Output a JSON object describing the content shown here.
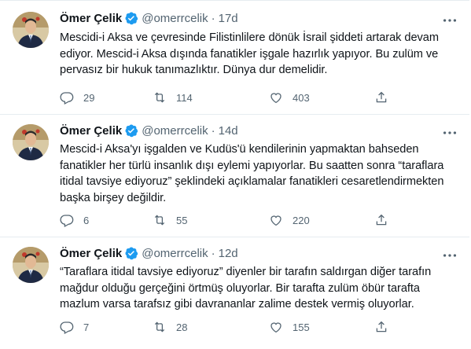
{
  "tweets": [
    {
      "name": "Ömer Çelik",
      "handle": "@omerrcelik",
      "separator": "·",
      "time": "17d",
      "text": "Mescidi-i Aksa ve çevresinde Filistinlilere dönük İsrail şiddeti artarak devam ediyor. Mescid-i Aksa dışında fanatikler işgale hazırlık yapıyor. Bu zulüm ve pervasız bir hukuk tanımazlıktır. Dünya dur demelidir.",
      "replies": "29",
      "retweets": "114",
      "likes": "403"
    },
    {
      "name": "Ömer Çelik",
      "handle": "@omerrcelik",
      "separator": "·",
      "time": "14d",
      "text": "Mescid-i Aksa'yı işgalden ve Kudüs'ü kendilerinin yapmaktan bahseden fanatikler her türlü insanlık dışı eylemi yapıyorlar. Bu saatten sonra “taraflara itidal tavsiye ediyoruz” şeklindeki açıklamalar fanatikleri cesaretlendirmekten başka birşey değildir.",
      "replies": "6",
      "retweets": "55",
      "likes": "220"
    },
    {
      "name": "Ömer Çelik",
      "handle": "@omerrcelik",
      "separator": "·",
      "time": "12d",
      "text": "“Taraflara itidal tavsiye ediyoruz” diyenler bir tarafın saldırgan diğer tarafın mağdur olduğu gerçeğini örtmüş oluyorlar. Bir tarafta zulüm öbür tarafta mazlum varsa tarafsız gibi davrananlar zalime destek vermiş oluyorlar.",
      "replies": "7",
      "retweets": "28",
      "likes": "155"
    }
  ],
  "icons": {
    "verified": "verified-badge-icon",
    "more": "more-options-icon",
    "reply": "reply-icon",
    "retweet": "retweet-icon",
    "like": "like-icon",
    "share": "share-icon"
  },
  "colors": {
    "verified": "#1d9bf0",
    "secondary_text": "#536471",
    "divider": "#e6ecf0"
  }
}
